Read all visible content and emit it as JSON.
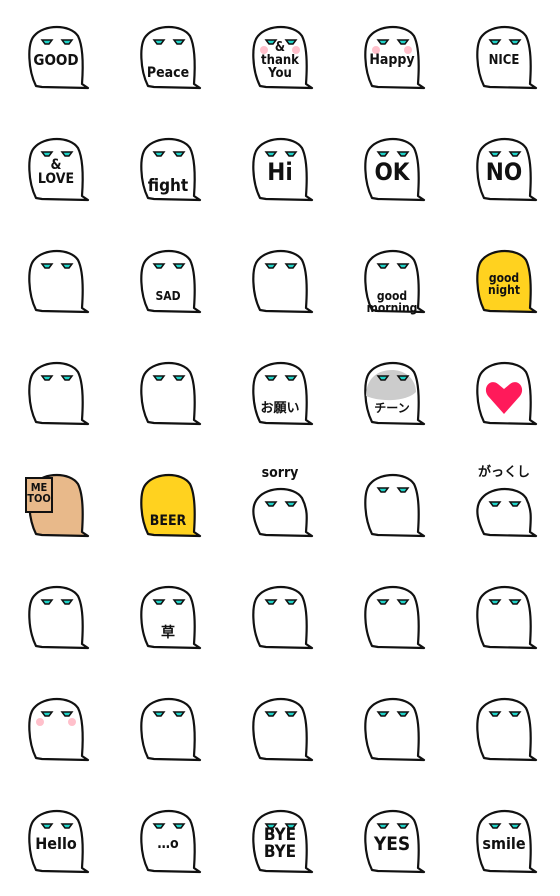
{
  "colors": {
    "eye": "#1fd3c8",
    "outline": "#111111",
    "blush": "#ffc0cb",
    "heart": "#ff1a5a",
    "yellow": "#ffd21f",
    "sign": "#e8b98a",
    "gray": "#cccccc",
    "green": "#33aa44"
  },
  "stickers": [
    {
      "text": "GOOD",
      "icon": "thumbs-up-ghost-icon",
      "size": 15,
      "pos": "mid"
    },
    {
      "text": "Peace",
      "icon": "peace-sign-ghost-icon",
      "size": 14,
      "pos": "low"
    },
    {
      "text": "&\nthank\nYou",
      "icon": "blushing-ghost-icon",
      "size": 13,
      "pos": "mid",
      "blush": true
    },
    {
      "text": "Happy",
      "icon": "blushing-ghost-icon",
      "size": 14,
      "pos": "mid",
      "blush": true
    },
    {
      "text": "NICE",
      "icon": "sign-ghost-icon",
      "size": 13,
      "pos": "mid"
    },
    {
      "text": "&\nLOVE",
      "icon": "love-ghost-icon",
      "size": 14,
      "pos": "mid"
    },
    {
      "text": "fight",
      "icon": "fight-ghost-icon",
      "size": 17,
      "pos": "low"
    },
    {
      "text": "Hi",
      "icon": "hi-ghost-icon",
      "size": 24,
      "pos": "mid"
    },
    {
      "text": "OK",
      "icon": "ok-ghost-icon",
      "size": 24,
      "pos": "mid"
    },
    {
      "text": "NO",
      "icon": "no-ghost-icon",
      "size": 24,
      "pos": "mid"
    },
    {
      "text": "",
      "icon": "crying-ghost-icon",
      "pos": "mid"
    },
    {
      "text": "SAD",
      "icon": "sad-ghost-icon",
      "size": 12,
      "pos": "low"
    },
    {
      "text": "",
      "icon": "wailing-ghost-icon",
      "pos": "mid"
    },
    {
      "text": "good\nmorning",
      "icon": "rooster-ghost-icon",
      "size": 12,
      "pos": "low"
    },
    {
      "text": "good\nnight",
      "icon": "moon-ghost-icon",
      "size": 12,
      "pos": "mid",
      "fill": "yellow"
    },
    {
      "text": "",
      "icon": "flower-ghost-icon",
      "pos": "mid"
    },
    {
      "text": "",
      "icon": "cheerleader-ghost-icon",
      "pos": "mid"
    },
    {
      "text": "お願い",
      "icon": "please-ghost-icon",
      "size": 13,
      "pos": "low"
    },
    {
      "text": "チーン",
      "icon": "gloomy-ghost-icon",
      "size": 12,
      "pos": "low",
      "fill": "gray"
    },
    {
      "text": "",
      "icon": "heart-ghost-icon",
      "pos": "mid",
      "heart": true
    },
    {
      "text": "ME\nTOO",
      "icon": "me-too-sign-ghost-icon",
      "size": 11,
      "pos": "sign",
      "fill": "sign"
    },
    {
      "text": "BEER",
      "icon": "beer-mug-ghost-icon",
      "size": 14,
      "pos": "low",
      "fill": "yellow"
    },
    {
      "text": "sorry",
      "icon": "sorry-ghost-icon",
      "size": 14,
      "pos": "top"
    },
    {
      "text": "",
      "icon": "dizzy-ghost-icon",
      "pos": "mid"
    },
    {
      "text": "がっくし",
      "icon": "dejected-ghost-icon",
      "size": 13,
      "pos": "top"
    },
    {
      "text": "",
      "icon": "angry-ghost-icon",
      "pos": "mid"
    },
    {
      "text": "草",
      "icon": "laughing-ghost-icon",
      "size": 14,
      "pos": "low"
    },
    {
      "text": "",
      "icon": "shocked-ghost-icon",
      "pos": "mid"
    },
    {
      "text": "",
      "icon": "peeking-ghost-icon",
      "pos": "mid"
    },
    {
      "text": "",
      "icon": "smug-ghost-icon",
      "pos": "mid"
    },
    {
      "text": "",
      "icon": "smiling-ghost-icon",
      "pos": "mid",
      "blush": true
    },
    {
      "text": "",
      "icon": "sparkle-ghost-icon",
      "pos": "mid"
    },
    {
      "text": "",
      "icon": "content-ghost-icon",
      "pos": "mid"
    },
    {
      "text": "",
      "icon": "grinning-ghost-icon",
      "pos": "mid"
    },
    {
      "text": "",
      "icon": "sleepy-ghost-icon",
      "pos": "mid"
    },
    {
      "text": "Hello",
      "icon": "hello-ghost-icon",
      "size": 16,
      "pos": "mid"
    },
    {
      "text": "…o",
      "icon": "ellipsis-ghost-icon",
      "size": 14,
      "pos": "mid"
    },
    {
      "text": "BYE\nBYE",
      "icon": "bye-ghost-icon",
      "size": 17,
      "pos": "mid"
    },
    {
      "text": "YES",
      "icon": "yes-ghost-icon",
      "size": 19,
      "pos": "mid"
    },
    {
      "text": "smile",
      "icon": "smile-ghost-icon",
      "size": 16,
      "pos": "mid"
    }
  ]
}
